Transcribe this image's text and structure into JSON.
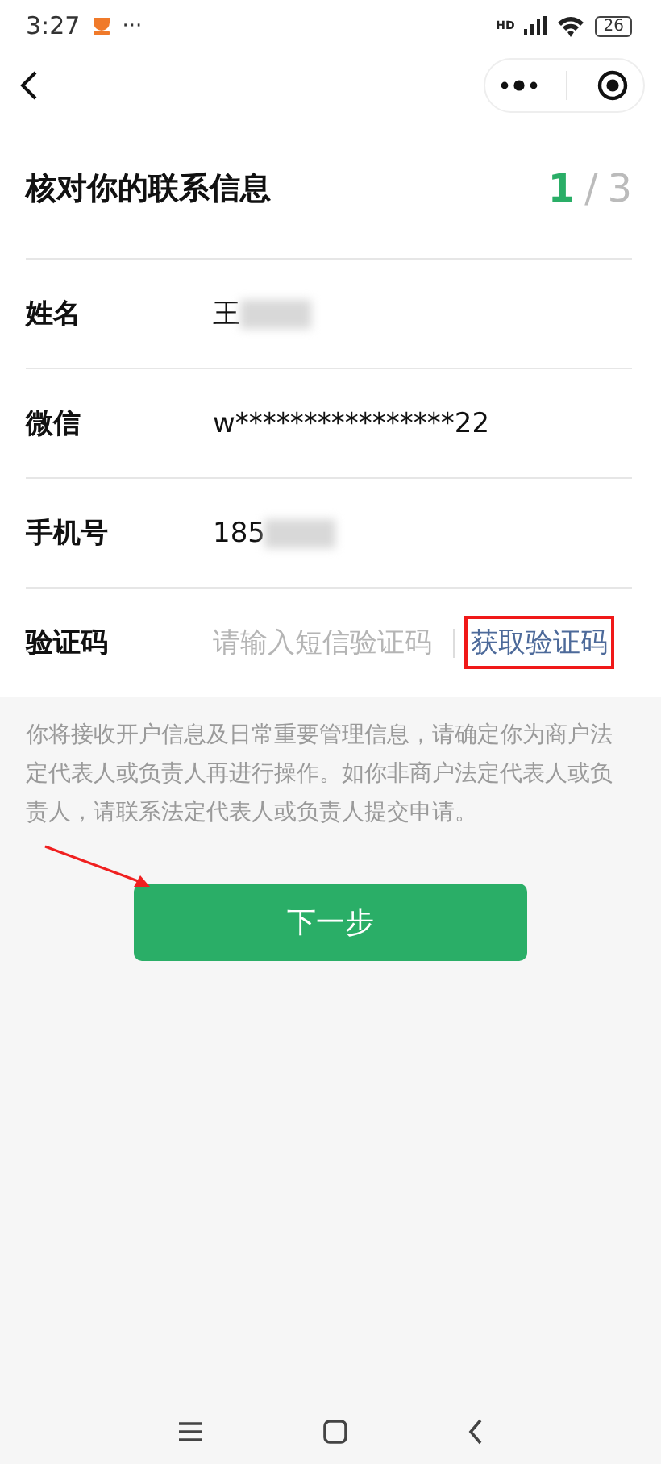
{
  "status_bar": {
    "time": "3:27",
    "more": "···",
    "network": "HD",
    "battery": "26"
  },
  "title": "核对你的联系信息",
  "step": {
    "current": "1",
    "separator": "/",
    "total": "3"
  },
  "rows": [
    {
      "kind": "text",
      "label": "姓名",
      "value": "王",
      "masked": true
    },
    {
      "kind": "text",
      "label": "微信",
      "value": "w****************22",
      "masked": false
    },
    {
      "kind": "text",
      "label": "手机号",
      "value": "185",
      "masked": true
    },
    {
      "kind": "code",
      "label": "验证码",
      "placeholder": "请输入短信验证码",
      "action": "获取验证码",
      "highlighted": true
    }
  ],
  "note": "你将接收开户信息及日常重要管理信息，请确定你为商户法定代表人或负责人再进行操作。如你非商户法定代表人或负责人，请联系法定代表人或负责人提交申请。",
  "next_button": {
    "label": "下一步",
    "pointed_at": true
  }
}
